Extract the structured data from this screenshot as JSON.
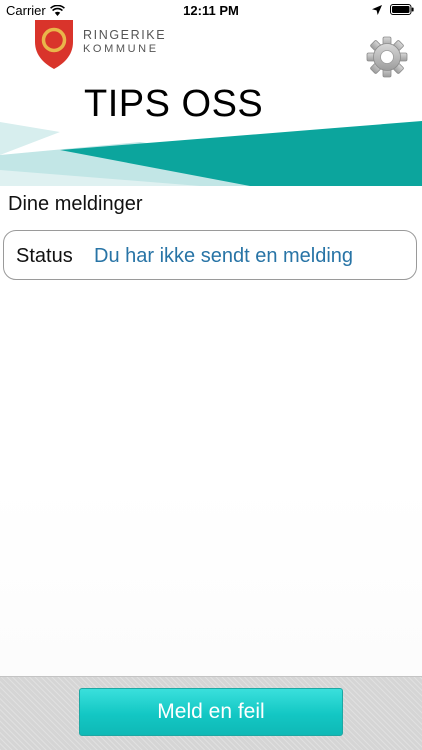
{
  "status_bar": {
    "carrier": "Carrier",
    "time": "12:11 PM",
    "icons": [
      "wifi-icon",
      "location-icon",
      "battery-icon"
    ]
  },
  "header": {
    "brand_line1": "RINGERIKE",
    "brand_line2": "KOMMUNE",
    "title": "TIPS OSS",
    "logo_icon": "crest-icon",
    "settings_icon": "gear-icon"
  },
  "messages": {
    "heading": "Dine meldinger",
    "status_label": "Status",
    "status_value": "Du har ikke sendt en melding"
  },
  "footer": {
    "report_button_label": "Meld en feil"
  },
  "colors": {
    "teal": "#0aa59c",
    "light_teal": "#bfe8e8",
    "status_value_blue": "#2874a6",
    "button_teal": "#18cbc8",
    "crest_red": "#d9342b",
    "crest_ring": "#e9b64a"
  }
}
